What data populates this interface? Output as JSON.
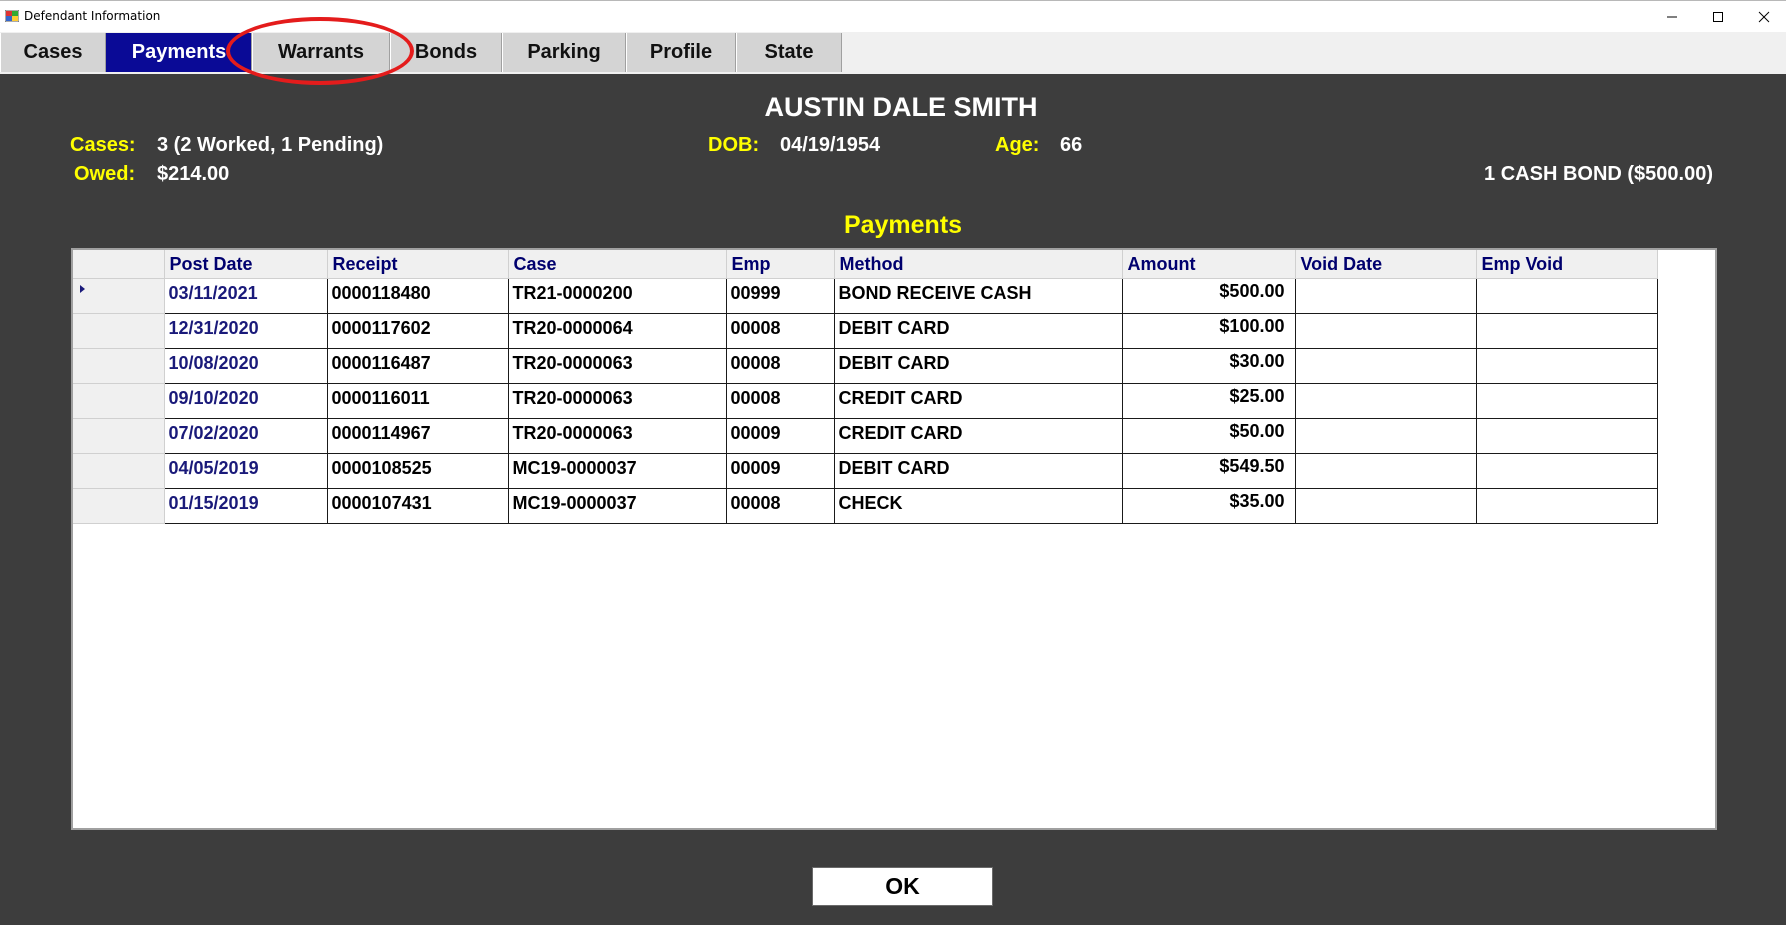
{
  "window": {
    "title": "Defendant Information",
    "icon": "app-icon",
    "controls": {
      "minimize": "—",
      "maximize": "☐",
      "close": "✕"
    }
  },
  "tabs": [
    {
      "label": "Cases",
      "active": false
    },
    {
      "label": "Payments",
      "active": true
    },
    {
      "label": "Warrants",
      "active": false
    },
    {
      "label": "Bonds",
      "active": false
    },
    {
      "label": "Parking",
      "active": false
    },
    {
      "label": "Profile",
      "active": false
    },
    {
      "label": "State",
      "active": false
    }
  ],
  "annotation": {
    "color": "#e41c1c",
    "target": "Warrants"
  },
  "defendant": {
    "name": "AUSTIN DALE SMITH",
    "cases_label": "Cases:",
    "cases_value": "3 (2 Worked, 1 Pending)",
    "owed_label": "Owed:",
    "owed_value": "$214.00",
    "dob_label": "DOB:",
    "dob_value": "04/19/1954",
    "age_label": "Age:",
    "age_value": "66",
    "bond_summary": "1 CASH BOND ($500.00)"
  },
  "payments": {
    "title": "Payments",
    "columns": [
      "Post Date",
      "Receipt",
      "Case",
      "Emp",
      "Method",
      "Amount",
      "Void Date",
      "Emp Void"
    ],
    "rows": [
      {
        "post_date": "03/11/2021",
        "receipt": "0000118480",
        "case": "TR21-0000200",
        "emp": "00999",
        "method": "BOND RECEIVE CASH",
        "amount": "$500.00",
        "void_date": "",
        "emp_void": "",
        "selected": true
      },
      {
        "post_date": "12/31/2020",
        "receipt": "0000117602",
        "case": "TR20-0000064",
        "emp": "00008",
        "method": "DEBIT CARD",
        "amount": "$100.00",
        "void_date": "",
        "emp_void": ""
      },
      {
        "post_date": "10/08/2020",
        "receipt": "0000116487",
        "case": "TR20-0000063",
        "emp": "00008",
        "method": "DEBIT CARD",
        "amount": "$30.00",
        "void_date": "",
        "emp_void": ""
      },
      {
        "post_date": "09/10/2020",
        "receipt": "0000116011",
        "case": "TR20-0000063",
        "emp": "00008",
        "method": "CREDIT CARD",
        "amount": "$25.00",
        "void_date": "",
        "emp_void": ""
      },
      {
        "post_date": "07/02/2020",
        "receipt": "0000114967",
        "case": "TR20-0000063",
        "emp": "00009",
        "method": "CREDIT CARD",
        "amount": "$50.00",
        "void_date": "",
        "emp_void": ""
      },
      {
        "post_date": "04/05/2019",
        "receipt": "0000108525",
        "case": "MC19-0000037",
        "emp": "00009",
        "method": "DEBIT CARD",
        "amount": "$549.50",
        "void_date": "",
        "emp_void": ""
      },
      {
        "post_date": "01/15/2019",
        "receipt": "0000107431",
        "case": "MC19-0000037",
        "emp": "00008",
        "method": "CHECK",
        "amount": "$35.00",
        "void_date": "",
        "emp_void": ""
      }
    ]
  },
  "ok_button": {
    "label": "OK"
  },
  "colors": {
    "background": "#3d3d3d",
    "active_tab": "#0a0a96",
    "label_yellow": "#ffff00",
    "header_text": "#00006e"
  }
}
